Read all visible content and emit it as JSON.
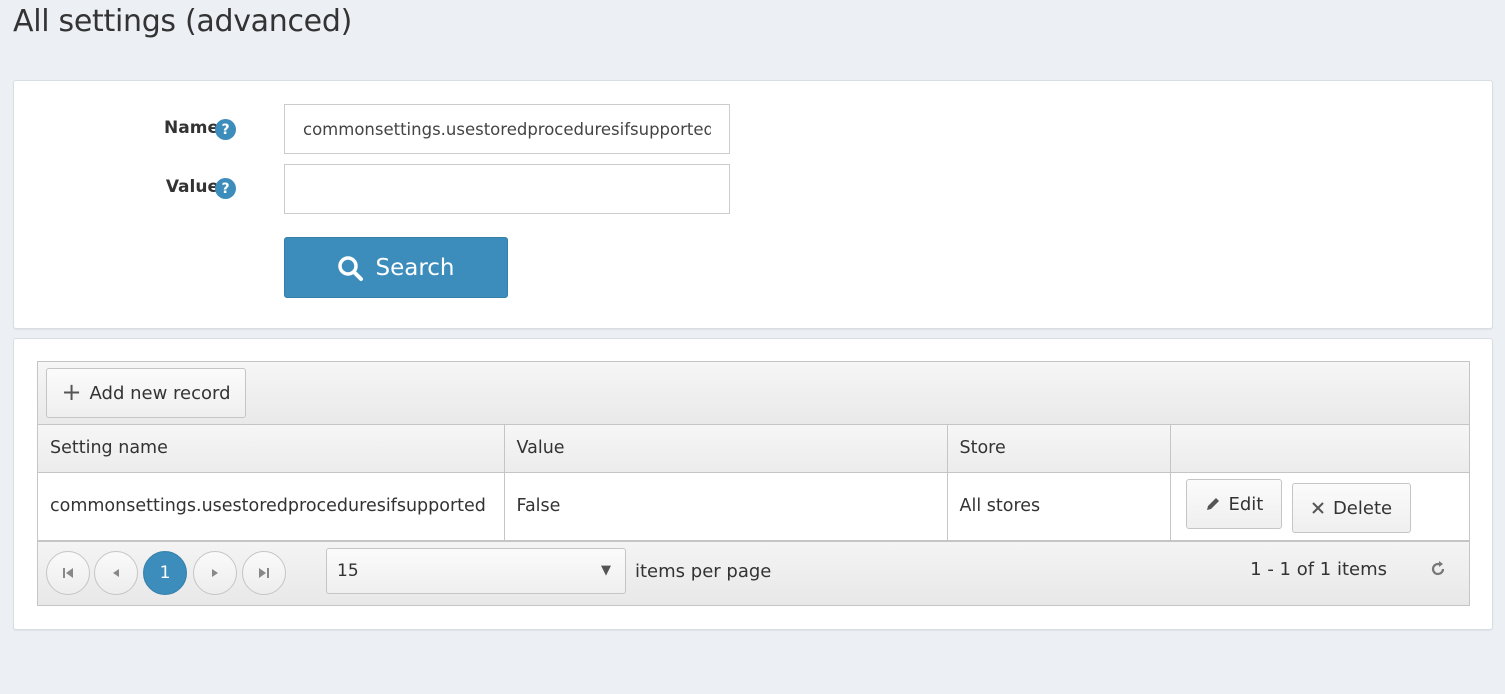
{
  "page": {
    "title": "All settings (advanced)"
  },
  "search": {
    "name_label": "Name",
    "name_value": "commonsettings.usestoredproceduresifsupported",
    "value_label": "Value",
    "value_value": "",
    "help_glyph": "?",
    "button_label": "Search",
    "accent_color": "#3c8dbc"
  },
  "grid": {
    "add_label": "Add new record",
    "columns": [
      "Setting name",
      "Value",
      "Store",
      ""
    ],
    "rows": [
      {
        "name": "commonsettings.usestoredproceduresifsupported",
        "value": "False",
        "store": "All stores",
        "edit_label": "Edit",
        "delete_label": "Delete"
      }
    ]
  },
  "pager": {
    "current_page": "1",
    "page_size": "15",
    "items_per_page_label": "items per page",
    "summary": "1 - 1 of 1 items"
  }
}
